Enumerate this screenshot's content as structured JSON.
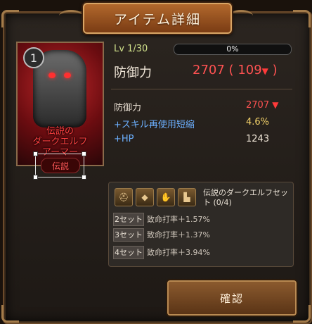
{
  "dialog": {
    "title": "アイテム詳細"
  },
  "item": {
    "count_badge": "1",
    "name_line1": "伝説の",
    "name_line2": "ダークエルフ",
    "name_line3": "アーマー",
    "rarity": "伝説"
  },
  "level": {
    "label": "Lv 1/30",
    "progress_text": "0%",
    "progress": 0
  },
  "main_stat": {
    "label": "防御力",
    "value": "2707",
    "paren_open": "(",
    "delta": "109",
    "paren_close": ")"
  },
  "stats": [
    {
      "label": "防御力",
      "value": "2707",
      "label_color": "#e6ddd0",
      "value_color": "#ff5252",
      "arrow": "▼"
    },
    {
      "label": "+スキル再使用短縮",
      "value": "4.6%",
      "label_color": "#6cb0ff",
      "value_color": "#f5d36a",
      "arrow": ""
    },
    {
      "label": "+HP",
      "value": "1243",
      "label_color": "#6cb0ff",
      "value_color": "#f0e6d8",
      "arrow": ""
    }
  ],
  "set": {
    "title": "伝説のダークエルフセット (0/4)",
    "icons": [
      "helmet-icon",
      "armor-icon",
      "gloves-icon",
      "boots-icon"
    ],
    "bonuses": [
      {
        "tag": "2セット",
        "text": "致命打率＋1.57%"
      },
      {
        "tag": "3セット",
        "text": "致命打率＋1.37%"
      },
      {
        "tag": "4セット",
        "text": "致命打率＋3.94%"
      }
    ]
  },
  "buttons": {
    "confirm": "確認"
  },
  "colors": {
    "accent": "#b2682c",
    "negative": "#ff5252",
    "positive": "#f5d36a",
    "bonus_blue": "#6cb0ff"
  }
}
